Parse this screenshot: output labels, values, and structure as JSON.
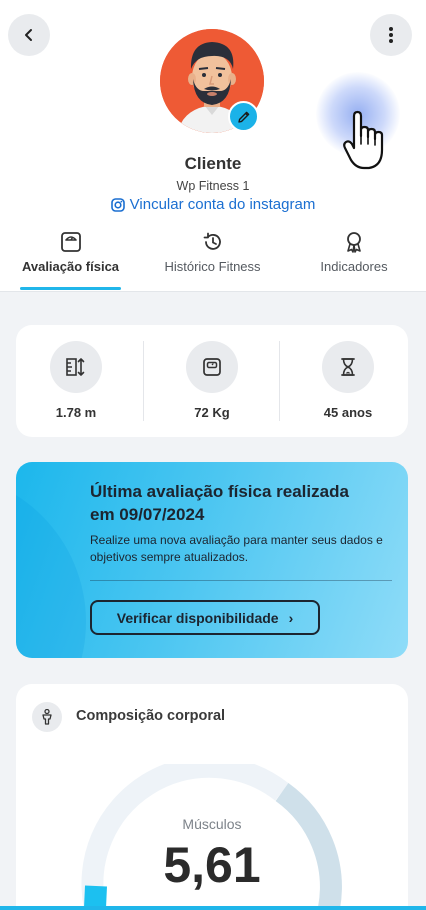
{
  "profile": {
    "name": "Cliente",
    "company": "Wp Fitness 1",
    "instagram_link": "Vincular conta do instagram"
  },
  "tabs": [
    {
      "label": "Avaliação física",
      "icon": "scale-icon",
      "active": true
    },
    {
      "label": "Histórico Fitness",
      "icon": "history-icon",
      "active": false
    },
    {
      "label": "Indicadores",
      "icon": "award-icon",
      "active": false
    }
  ],
  "stats": [
    {
      "icon": "height-icon",
      "value": "1.78 m"
    },
    {
      "icon": "weight-scale-icon",
      "value": "72 Kg"
    },
    {
      "icon": "hourglass-icon",
      "value": "45 anos"
    }
  ],
  "promo": {
    "title_line1": "Última avaliação física realizada",
    "title_line2": "em  09/07/2024",
    "description": "Realize uma nova avaliação para manter seus dados e objetivos sempre atualizados.",
    "button_label": "Verificar disponibilidade",
    "button_chevron": "›"
  },
  "composition": {
    "title": "Composição corporal",
    "metric_label": "Músculos",
    "metric_value": "5,61"
  },
  "colors": {
    "accent": "#20b6ea",
    "avatar_bg": "#ee5a35",
    "link": "#1b6fd1"
  }
}
